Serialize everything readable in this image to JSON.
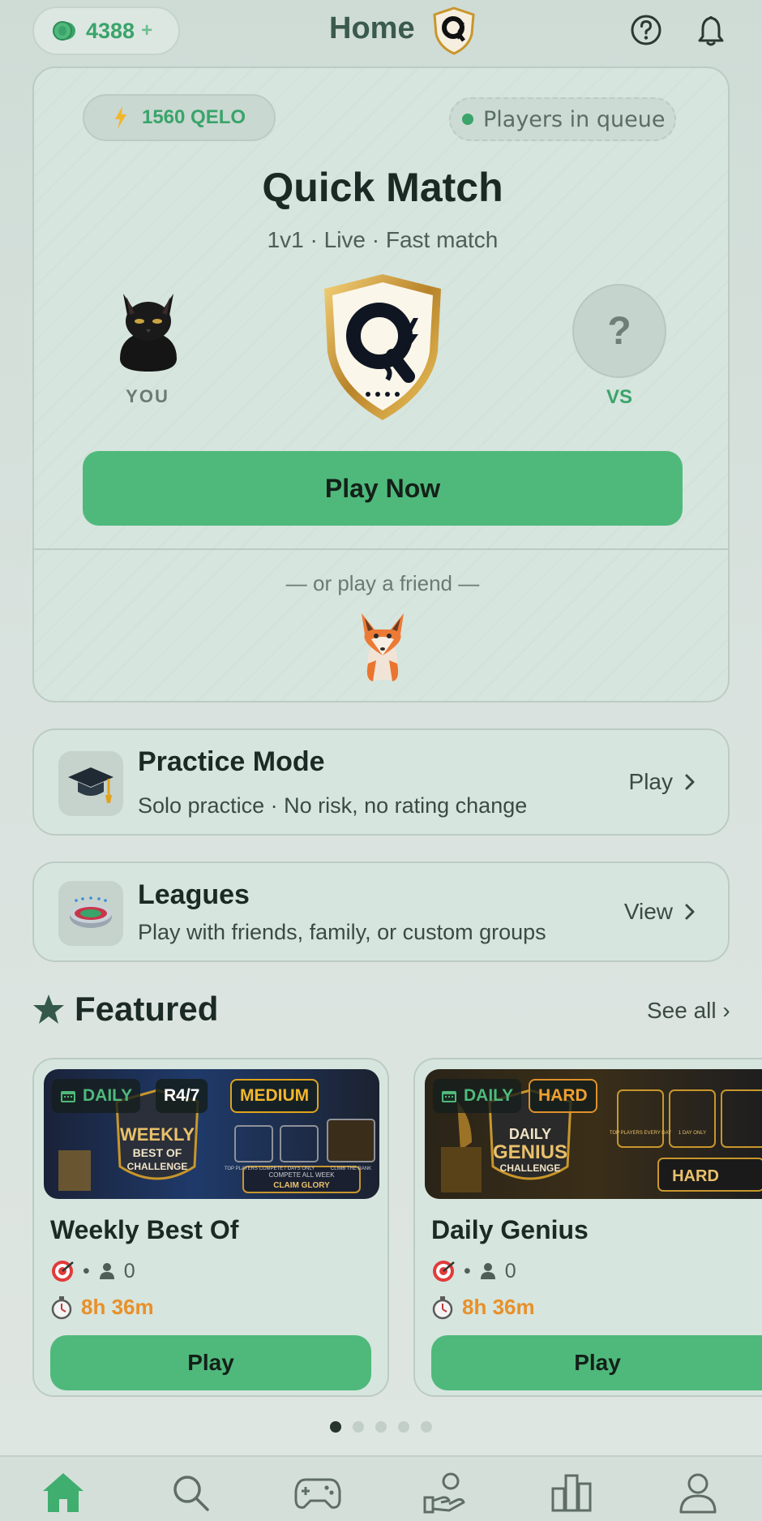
{
  "header": {
    "coins": "4388",
    "coins_plus": "+",
    "title": "Home",
    "help_icon": "question-circle-icon",
    "notifications_icon": "bell-icon"
  },
  "quick_match": {
    "rating": "1560 QELO",
    "queue_status": "Players in queue",
    "title": "Quick Match",
    "subtitle": "1v1 · Live · Fast match",
    "you_label": "YOU",
    "opponent_placeholder": "?",
    "vs_label": "VS",
    "play_label": "Play Now",
    "friend_label": "— or play a friend —"
  },
  "practice": {
    "title": "Practice Mode",
    "description": "Solo practice · No risk, no rating change",
    "action": "Play",
    "icon": "graduation-cap-icon"
  },
  "leagues": {
    "title": "Leagues",
    "description": "Play with friends, family, or custom groups",
    "action": "View",
    "icon": "stadium-icon"
  },
  "featured": {
    "title": "Featured",
    "see_all": "See all ›",
    "cards": [
      {
        "tag": "DAILY",
        "round": "R4/7",
        "difficulty": "MEDIUM",
        "name": "Weekly Best Of",
        "players": "0",
        "timer": "8h 36m",
        "play_label": "Play",
        "banner": {
          "line1": "WEEKLY",
          "line2": "BEST OF",
          "line3": "CHALLENGE",
          "feat1": "TOP PLAYERS COMPETE",
          "feat2": "7 DAYS ONLY",
          "feat3": "CLIMB THE RANK",
          "claim_top": "COMPETE ALL WEEK",
          "claim_bottom": "CLAIM GLORY"
        }
      },
      {
        "tag": "DAILY",
        "difficulty": "HARD",
        "name": "Daily Genius",
        "players": "0",
        "timer": "8h 36m",
        "play_label": "Play",
        "banner": {
          "line1": "DAILY",
          "line2": "GENIUS",
          "line3": "CHALLENGE",
          "feat1": "TOP PLAYERS EVERY DAY",
          "feat2": "1 DAY ONLY",
          "badge": "HARD"
        }
      }
    ],
    "pagination_count": 5,
    "pagination_active": 1
  },
  "nav": [
    "home-icon",
    "search-icon",
    "gamepad-icon",
    "hand-coin-icon",
    "leaderboard-icon",
    "profile-icon"
  ],
  "colors": {
    "accent": "#4fb97b",
    "accent_text": "#3aa46a",
    "timer": "#e8902a",
    "medium_tag": "#f2b62c",
    "hard_tag": "#f0a030"
  }
}
